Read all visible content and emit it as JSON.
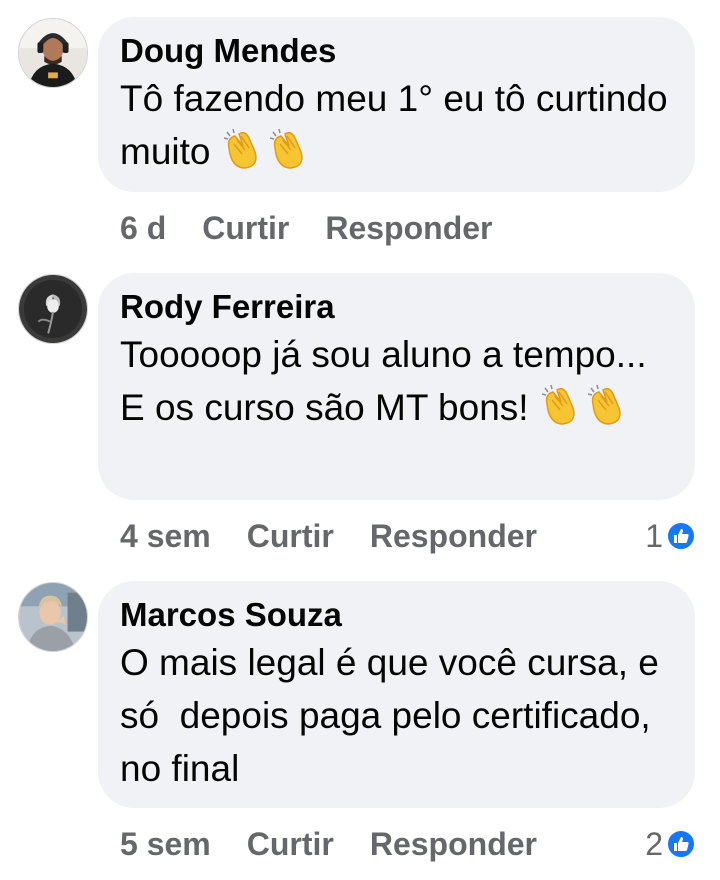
{
  "comments": [
    {
      "author": "Doug Mendes",
      "text": "Tô fazendo meu 1° eu tô curtindo muito",
      "emoji": [
        "clapping-hands",
        "clapping-hands"
      ],
      "time": "6 d",
      "like_label": "Curtir",
      "reply_label": "Responder",
      "reactions": ""
    },
    {
      "author": "Rody Ferreira",
      "text": "Tooooop já sou aluno a tempo... E os curso são MT bons!",
      "emoji": [
        "clapping-hands",
        "clapping-hands"
      ],
      "time": "4 sem",
      "like_label": "Curtir",
      "reply_label": "Responder",
      "reactions": "1"
    },
    {
      "author": "Marcos Souza",
      "text": "O mais legal é que você cursa, e só  depois paga pelo certificado, no final",
      "emoji": [],
      "time": "5 sem",
      "like_label": "Curtir",
      "reply_label": "Responder",
      "reactions": "2"
    }
  ],
  "colors": {
    "bubble": "#f0f2f5",
    "meta_text": "#65676b",
    "like_blue": "#1877f2"
  }
}
